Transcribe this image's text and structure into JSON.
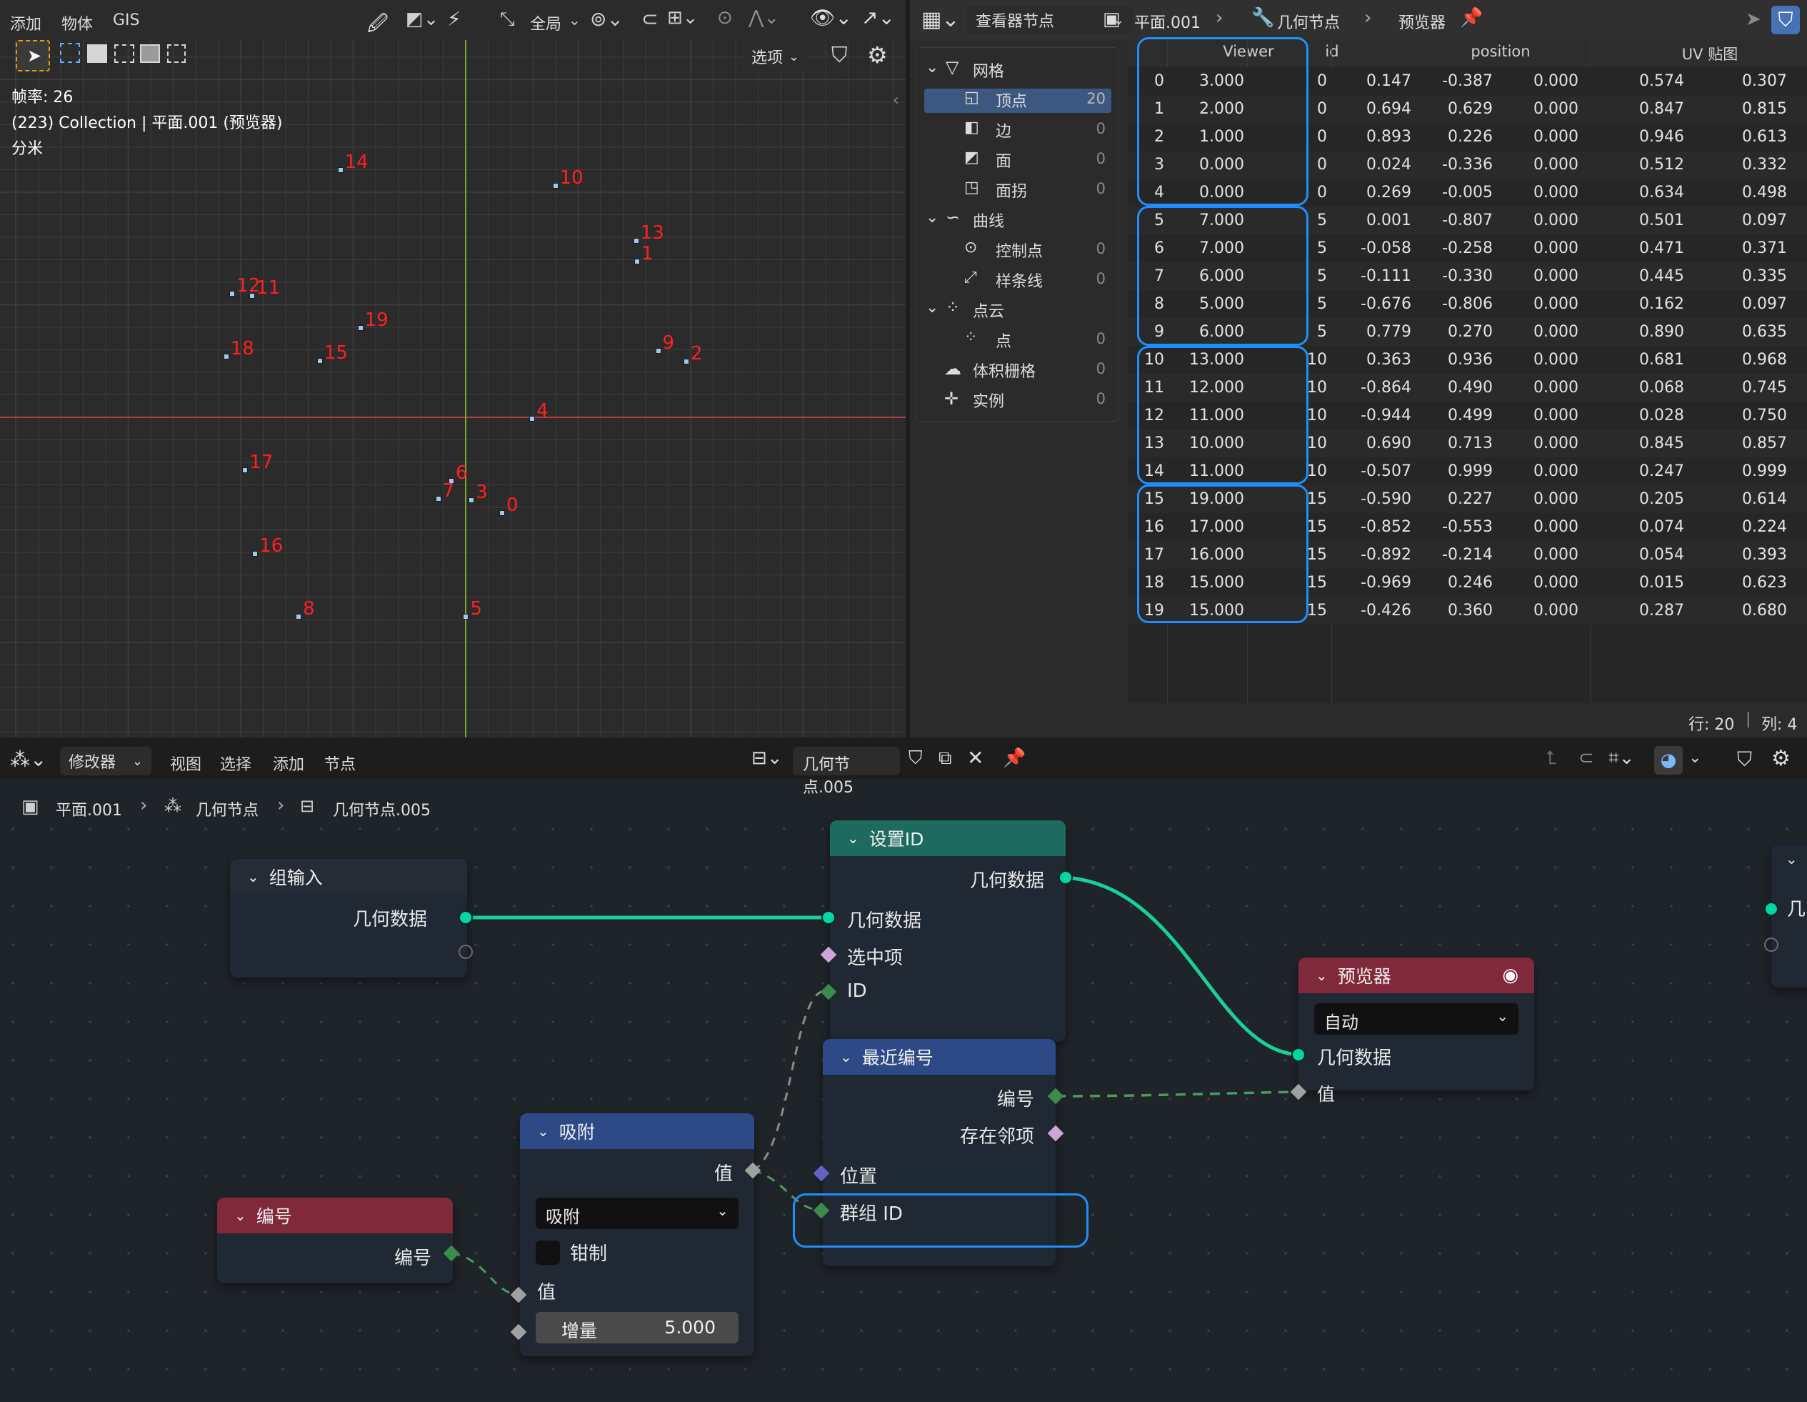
{
  "viewport": {
    "menu": [
      "添加",
      "物体",
      "GIS"
    ],
    "orientation": "全局",
    "options_label": "选项",
    "overlay": [
      "帧率: 26",
      "(223) Collection | 平面.001 (预览器)",
      "分米"
    ],
    "point_labels": [
      "0",
      "1",
      "2",
      "3",
      "4",
      "5",
      "6",
      "7",
      "8",
      "9",
      "10",
      "11",
      "12",
      "13",
      "14",
      "15",
      "16",
      "17",
      "18",
      "19"
    ]
  },
  "spreadsheet": {
    "editor_type": "查看器节点",
    "breadcrumb": [
      "平面.001",
      "几何节点",
      "预览器"
    ],
    "tree": {
      "mesh": "网格",
      "vertex": "顶点",
      "vertex_count": "20",
      "edge": "边",
      "edge_count": "0",
      "face": "面",
      "face_count": "0",
      "corner": "面拐",
      "corner_count": "0",
      "curve": "曲线",
      "control_point": "控制点",
      "control_point_count": "0",
      "spline": "样条线",
      "spline_count": "0",
      "pointcloud": "点云",
      "point": "点",
      "point_count": "0",
      "volume": "体积栅格",
      "volume_count": "0",
      "instance": "实例",
      "instance_count": "0"
    },
    "columns": [
      "Viewer",
      "id",
      "position",
      "UV 贴图"
    ],
    "rows": [
      [
        "0",
        "3.000",
        "0",
        "0.147",
        "-0.387",
        "0.000",
        "0.574",
        "0.307"
      ],
      [
        "1",
        "2.000",
        "0",
        "0.694",
        "0.629",
        "0.000",
        "0.847",
        "0.815"
      ],
      [
        "2",
        "1.000",
        "0",
        "0.893",
        "0.226",
        "0.000",
        "0.946",
        "0.613"
      ],
      [
        "3",
        "0.000",
        "0",
        "0.024",
        "-0.336",
        "0.000",
        "0.512",
        "0.332"
      ],
      [
        "4",
        "0.000",
        "0",
        "0.269",
        "-0.005",
        "0.000",
        "0.634",
        "0.498"
      ],
      [
        "5",
        "7.000",
        "5",
        "0.001",
        "-0.807",
        "0.000",
        "0.501",
        "0.097"
      ],
      [
        "6",
        "7.000",
        "5",
        "-0.058",
        "-0.258",
        "0.000",
        "0.471",
        "0.371"
      ],
      [
        "7",
        "6.000",
        "5",
        "-0.111",
        "-0.330",
        "0.000",
        "0.445",
        "0.335"
      ],
      [
        "8",
        "5.000",
        "5",
        "-0.676",
        "-0.806",
        "0.000",
        "0.162",
        "0.097"
      ],
      [
        "9",
        "6.000",
        "5",
        "0.779",
        "0.270",
        "0.000",
        "0.890",
        "0.635"
      ],
      [
        "10",
        "13.000",
        "10",
        "0.363",
        "0.936",
        "0.000",
        "0.681",
        "0.968"
      ],
      [
        "11",
        "12.000",
        "10",
        "-0.864",
        "0.490",
        "0.000",
        "0.068",
        "0.745"
      ],
      [
        "12",
        "11.000",
        "10",
        "-0.944",
        "0.499",
        "0.000",
        "0.028",
        "0.750"
      ],
      [
        "13",
        "10.000",
        "10",
        "0.690",
        "0.713",
        "0.000",
        "0.845",
        "0.857"
      ],
      [
        "14",
        "11.000",
        "10",
        "-0.507",
        "0.999",
        "0.000",
        "0.247",
        "0.999"
      ],
      [
        "15",
        "19.000",
        "15",
        "-0.590",
        "0.227",
        "0.000",
        "0.205",
        "0.614"
      ],
      [
        "16",
        "17.000",
        "15",
        "-0.852",
        "-0.553",
        "0.000",
        "0.074",
        "0.224"
      ],
      [
        "17",
        "16.000",
        "15",
        "-0.892",
        "-0.214",
        "0.000",
        "0.054",
        "0.393"
      ],
      [
        "18",
        "15.000",
        "15",
        "-0.969",
        "0.246",
        "0.000",
        "0.015",
        "0.623"
      ],
      [
        "19",
        "15.000",
        "15",
        "-0.426",
        "0.360",
        "0.000",
        "0.287",
        "0.680"
      ]
    ],
    "status_rows": "行: 20",
    "status_cols": "列: 4"
  },
  "node_editor": {
    "editor_type": "修改器",
    "menu": [
      "视图",
      "选择",
      "添加",
      "节点"
    ],
    "tree_name": "几何节点.005",
    "breadcrumb": [
      "平面.001",
      "几何节点",
      "几何节点.005"
    ],
    "nodes": {
      "group_input": {
        "title": "组输入",
        "out": "几何数据"
      },
      "set_id": {
        "title": "设置ID",
        "out": "几何数据",
        "in_geo": "几何数据",
        "in_sel": "选中项",
        "in_id": "ID"
      },
      "viewer": {
        "title": "预览器",
        "mode": "自动",
        "in_geo": "几何数据",
        "in_val": "值"
      },
      "index_of_nearest": {
        "title": "最近编号",
        "out_index": "编号",
        "out_has": "存在邻项",
        "in_pos": "位置",
        "in_group": "群组 ID"
      },
      "snap": {
        "title": "吸附",
        "out": "值",
        "mode": "吸附",
        "clamp": "钳制",
        "in_val": "值",
        "inc_label": "增量",
        "inc_value": "5.000"
      },
      "index": {
        "title": "编号",
        "out": "编号"
      },
      "group_output": {
        "title": "几"
      }
    }
  },
  "colors": {
    "accent": "#1f8fff",
    "geo_socket": "#00d6a3",
    "geo_link": "#1bcf9d",
    "float_socket": "#a1a1a1",
    "int_socket": "#3d8a4d",
    "bool_socket": "#cca6d6",
    "vector_socket": "#6363c7",
    "teal_header": "#1d6b5e",
    "blue_header": "#2d4a87",
    "pink_header": "#80293a",
    "point_label": "#ff2020",
    "x_axis": "#b63a4a",
    "y_axis": "#7fa82e"
  }
}
